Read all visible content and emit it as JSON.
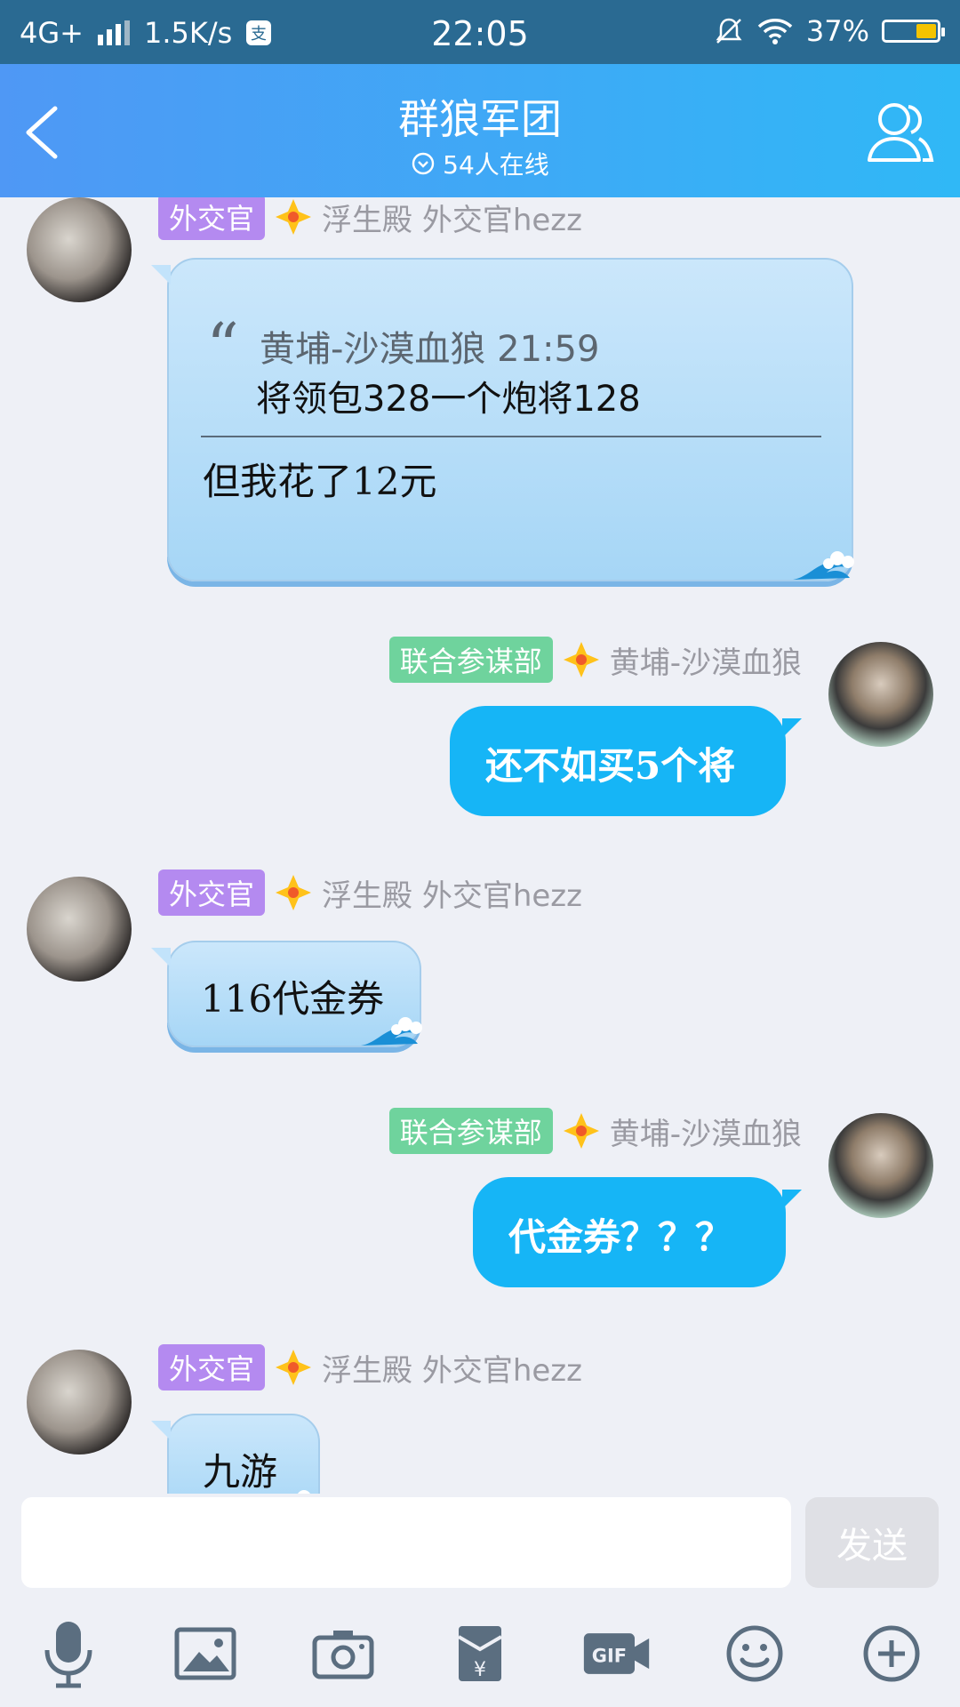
{
  "status_bar": {
    "network": "4G+",
    "speed": "1.5K/s",
    "time": "22:05",
    "battery": "37%"
  },
  "header": {
    "title": "群狼军团",
    "subtitle": "54人在线"
  },
  "messages": [
    {
      "tag": "外交官",
      "sender": "浮生殿 外交官hezz",
      "quote_author": "黄埔-沙漠血狼 21:59",
      "quote_text": "将领包328一个炮将128",
      "reply": "但我花了12元"
    },
    {
      "tag": "联合参谋部",
      "sender": "黄埔-沙漠血狼",
      "text": "还不如买5个将"
    },
    {
      "tag": "外交官",
      "sender": "浮生殿 外交官hezz",
      "text": "116代金券"
    },
    {
      "tag": "联合参谋部",
      "sender": "黄埔-沙漠血狼",
      "text": "代金券？？？"
    },
    {
      "tag": "外交官",
      "sender": "浮生殿 外交官hezz",
      "text": "九游"
    }
  ],
  "input": {
    "send_label": "发送"
  },
  "toolbar": {
    "items": [
      "voice-icon",
      "image-icon",
      "camera-icon",
      "red-packet-icon",
      "gif-icon",
      "emoji-icon",
      "plus-icon"
    ]
  },
  "colors": {
    "header_start": "#4f98f5",
    "header_end": "#30b8f6",
    "my_bubble": "#16b5f6",
    "tag_purple": "#b48af0",
    "tag_green": "#6fd39d"
  }
}
